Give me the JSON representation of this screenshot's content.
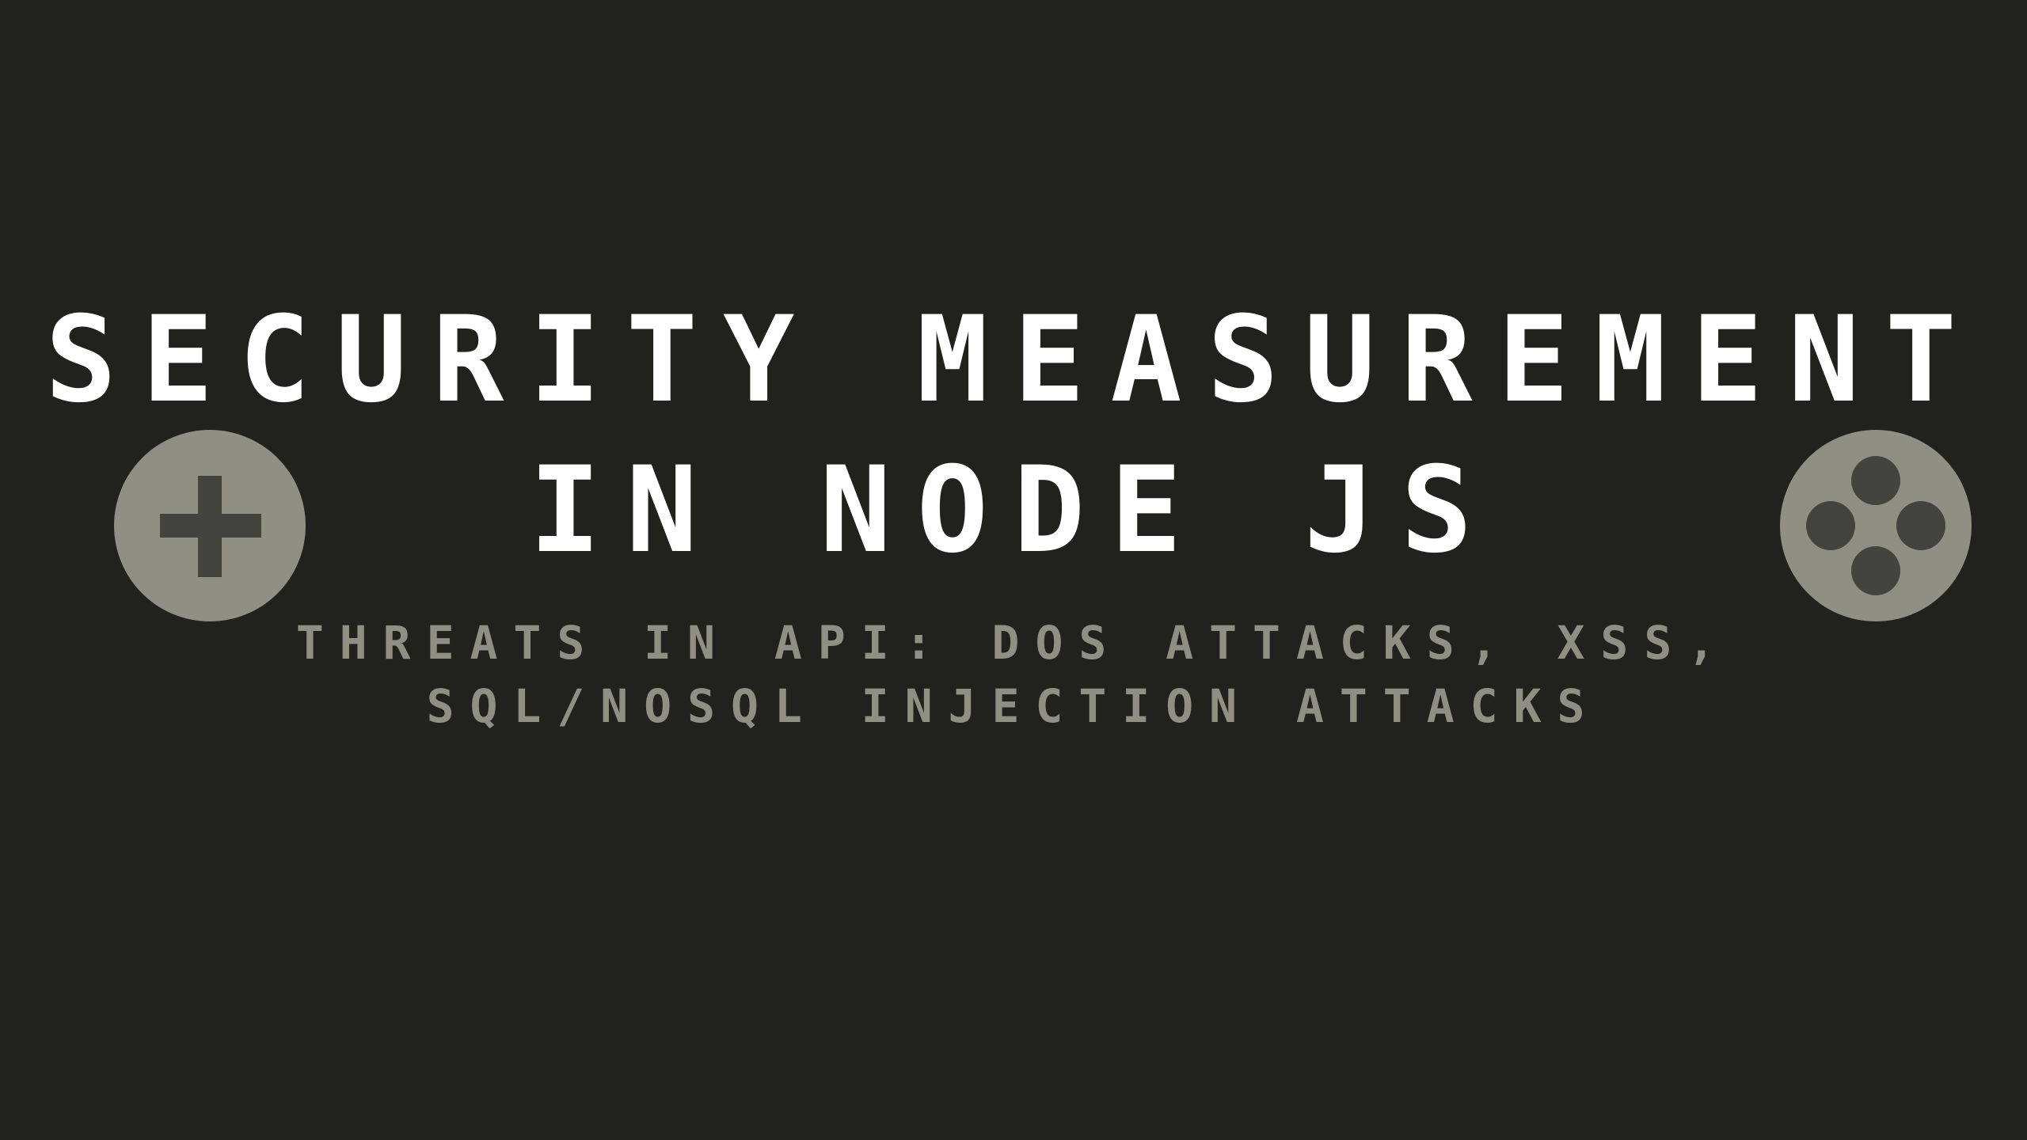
{
  "slide": {
    "title_lines": [
      "SECURITY MEASUREMENT",
      "IN NODE JS"
    ],
    "subtitle_lines": [
      "THREATS IN API: DOS ATTACKS, XSS,",
      "SQL/NOSQL INJECTION ATTACKS"
    ]
  },
  "icons": {
    "left": "dpad-plus-icon",
    "right": "four-buttons-icon"
  },
  "colors": {
    "background": "#21221e",
    "title": "#ffffff",
    "subtitle": "#8f8f84",
    "icon_circle": "#8f8f84",
    "icon_glyph": "#43443e"
  }
}
